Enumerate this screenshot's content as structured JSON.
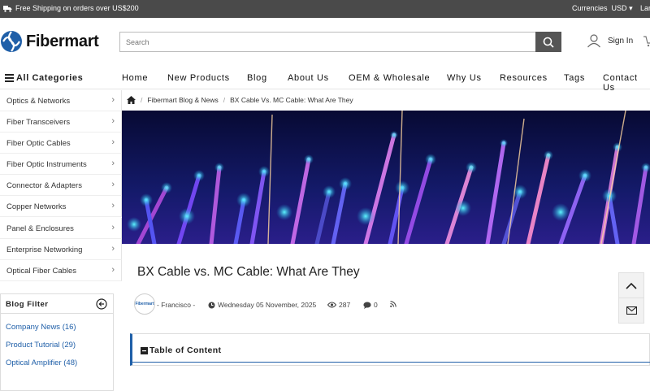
{
  "topbar": {
    "shipping": "Free Shipping on orders over US$200",
    "currencies_label": "Currencies",
    "currency": "USD",
    "language_partial": "Lar"
  },
  "brand": {
    "name": "Fibermart",
    "accent": "#1f5fa8",
    "topbar_bg": "#4a4a4a"
  },
  "search": {
    "placeholder": "Search"
  },
  "account": {
    "signin": "Sign In"
  },
  "nav": {
    "all_categories": "All Categories",
    "links": [
      "Home",
      "New Products",
      "Blog",
      "About Us",
      "OEM & Wholesale",
      "Why Us",
      "Resources",
      "Tags",
      "Contact Us"
    ]
  },
  "sidebar": {
    "categories": [
      "Optics & Networks",
      "Fiber Transceivers",
      "Fiber Optic Cables",
      "Fiber Optic Instruments",
      "Connector & Adapters",
      "Copper Networks",
      "Panel & Enclosures",
      "Enterprise Networking",
      "Optical Fiber Cables"
    ]
  },
  "blog_filter": {
    "title": "Blog Filter",
    "items": [
      "Company News (16)",
      "Product Tutorial (29)",
      "Optical Amplifier (48)"
    ]
  },
  "breadcrumb": {
    "items": [
      "Fibermart Blog & News",
      "BX Cable Vs. MC Cable: What Are They"
    ]
  },
  "article": {
    "title": "BX Cable vs. MC Cable: What Are They",
    "author": "- Francisco -",
    "avatar_text": "Fibermart",
    "date": "Wednesday 05 November, 2025",
    "views": "287",
    "comments": "0"
  },
  "toc": {
    "title": "Table of Content"
  },
  "icons": {
    "shipping": "truck-icon",
    "search": "search-icon",
    "user": "user-icon",
    "cart": "cart-icon",
    "menu": "hamburger-icon",
    "home": "home-icon",
    "chevron": "chevron-right-icon",
    "collapse": "arrow-left-circle-icon",
    "date": "clock-icon",
    "views": "eye-icon",
    "comments": "comment-icon",
    "rss": "rss-icon",
    "top": "chevron-up-icon",
    "mail": "mail-icon"
  }
}
